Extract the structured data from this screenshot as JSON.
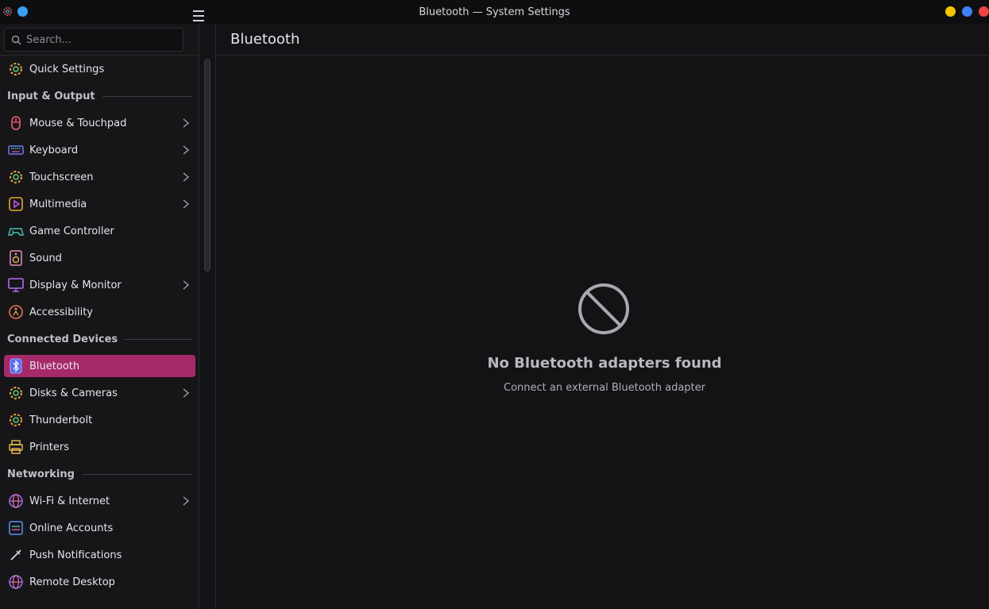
{
  "window": {
    "title": "Bluetooth — System Settings"
  },
  "search": {
    "placeholder": "Search..."
  },
  "page": {
    "title": "Bluetooth"
  },
  "sidebar": {
    "quick_settings": "Quick Settings",
    "sections": {
      "input_output": "Input & Output",
      "connected_devices": "Connected Devices",
      "networking": "Networking"
    },
    "items": {
      "mouse": "Mouse & Touchpad",
      "keyboard": "Keyboard",
      "touchscreen": "Touchscreen",
      "multimedia": "Multimedia",
      "game_controller": "Game Controller",
      "sound": "Sound",
      "display": "Display & Monitor",
      "accessibility": "Accessibility",
      "bluetooth": "Bluetooth",
      "disks": "Disks & Cameras",
      "thunderbolt": "Thunderbolt",
      "printers": "Printers",
      "wifi": "Wi-Fi & Internet",
      "online_accounts": "Online Accounts",
      "push_notifications": "Push Notifications",
      "remote_desktop": "Remote Desktop"
    }
  },
  "empty_state": {
    "heading": "No Bluetooth adapters found",
    "subtext": "Connect an external Bluetooth adapter",
    "icon": "no-entry-icon"
  },
  "colors": {
    "accent": "#a62a6a",
    "window_min": "#f5c400",
    "window_max": "#3b82f6",
    "window_close": "#ef4444"
  }
}
